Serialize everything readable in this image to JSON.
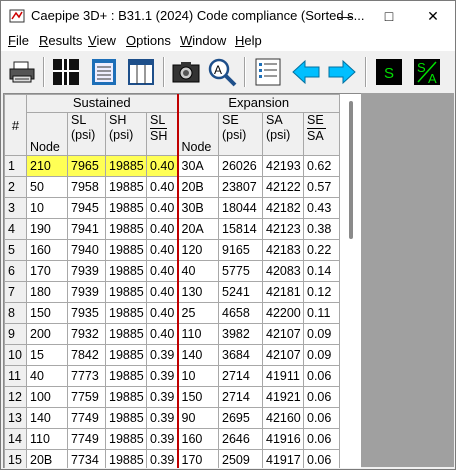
{
  "window": {
    "title": "Caepipe 3D+ : B31.1 (2024) Code compliance (Sorted s...",
    "minimize_icon": "minimize-icon",
    "maximize_icon": "maximize-icon",
    "close_icon": "close-icon"
  },
  "menu": {
    "items": [
      {
        "label": "File"
      },
      {
        "label": "Results"
      },
      {
        "label": "View"
      },
      {
        "label": "Options"
      },
      {
        "label": "Window"
      },
      {
        "label": "Help"
      }
    ]
  },
  "toolbar": {
    "buttons": [
      "print-icon",
      "grid-icon",
      "notepad-icon",
      "columns-icon",
      "camera-icon",
      "zoom-icon",
      "list-icon",
      "arrow-left-icon",
      "arrow-right-icon",
      "s-icon",
      "s-over-a-icon"
    ],
    "s_label": "S",
    "sa_top": "S",
    "sa_bottom": "A"
  },
  "table": {
    "corner": "#",
    "groups": {
      "sustained": "Sustained",
      "expansion": "Expansion"
    },
    "headers": {
      "node": "Node",
      "sl": "SL",
      "sl_unit": "(psi)",
      "sh": "SH",
      "sh_unit": "(psi)",
      "slsh_num": "SL",
      "slsh_den": "SH",
      "node2": "Node",
      "se": "SE",
      "se_unit": "(psi)",
      "sa": "SA",
      "sa_unit": "(psi)",
      "sesa_num": "SE",
      "sesa_den": "SA"
    },
    "rows": [
      [
        "1",
        "210",
        "7965",
        "19885",
        "0.40",
        "30A",
        "26026",
        "42193",
        "0.62"
      ],
      [
        "2",
        "50",
        "7958",
        "19885",
        "0.40",
        "20B",
        "23807",
        "42122",
        "0.57"
      ],
      [
        "3",
        "10",
        "7945",
        "19885",
        "0.40",
        "30B",
        "18044",
        "42182",
        "0.43"
      ],
      [
        "4",
        "190",
        "7941",
        "19885",
        "0.40",
        "20A",
        "15814",
        "42123",
        "0.38"
      ],
      [
        "5",
        "160",
        "7940",
        "19885",
        "0.40",
        "120",
        "9165",
        "42183",
        "0.22"
      ],
      [
        "6",
        "170",
        "7939",
        "19885",
        "0.40",
        "40",
        "5775",
        "42083",
        "0.14"
      ],
      [
        "7",
        "180",
        "7939",
        "19885",
        "0.40",
        "130",
        "5241",
        "42181",
        "0.12"
      ],
      [
        "8",
        "150",
        "7935",
        "19885",
        "0.40",
        "25",
        "4658",
        "42200",
        "0.11"
      ],
      [
        "9",
        "200",
        "7932",
        "19885",
        "0.40",
        "110",
        "3982",
        "42107",
        "0.09"
      ],
      [
        "10",
        "15",
        "7842",
        "19885",
        "0.39",
        "140",
        "3684",
        "42107",
        "0.09"
      ],
      [
        "11",
        "40",
        "7773",
        "19885",
        "0.39",
        "10",
        "2714",
        "41911",
        "0.06"
      ],
      [
        "12",
        "100",
        "7759",
        "19885",
        "0.39",
        "150",
        "2714",
        "41921",
        "0.06"
      ],
      [
        "13",
        "140",
        "7749",
        "19885",
        "0.39",
        "90",
        "2695",
        "42160",
        "0.06"
      ],
      [
        "14",
        "110",
        "7749",
        "19885",
        "0.39",
        "160",
        "2646",
        "41916",
        "0.06"
      ],
      [
        "15",
        "20B",
        "7734",
        "19885",
        "0.39",
        "170",
        "2509",
        "41917",
        "0.06"
      ]
    ]
  },
  "colors": {
    "highlight": "#ffff55",
    "separator": "#c00000",
    "arrow": "#00bfff",
    "s_button": "#00c000"
  }
}
